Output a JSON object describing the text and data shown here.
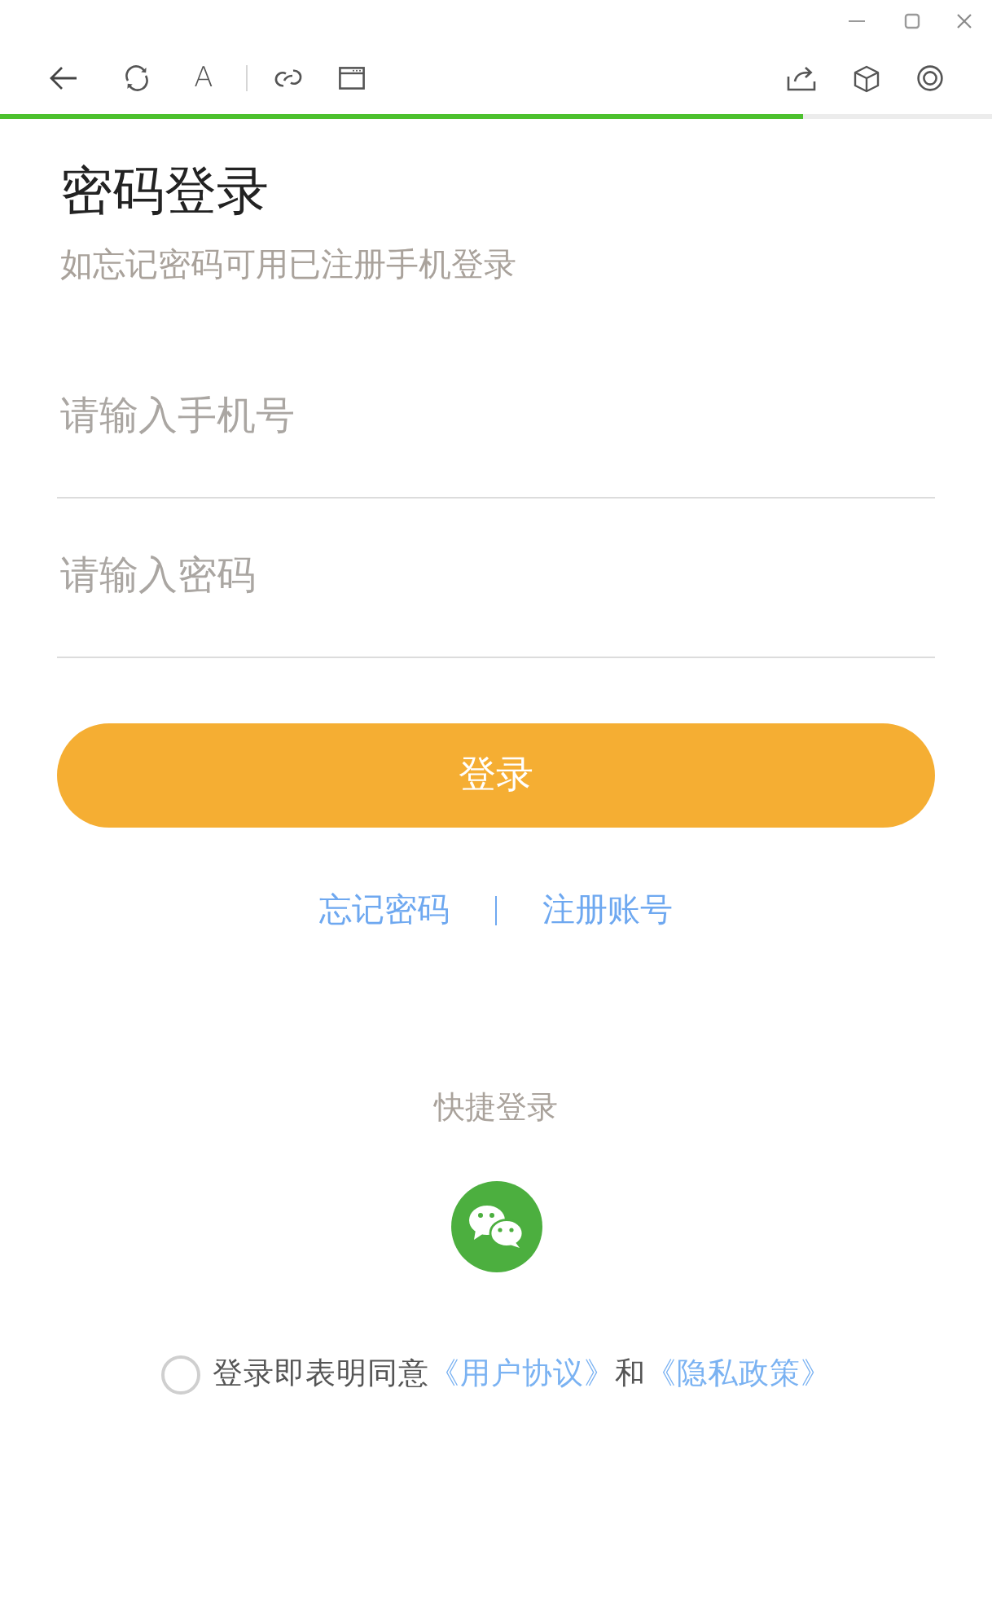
{
  "toolbar": {
    "font_size_label": "A",
    "progress": {
      "level": 0.81
    }
  },
  "title": "密码登录",
  "subtitle": "如忘记密码可用已注册手机登录",
  "phone_field": {
    "placeholder": "请输入手机号"
  },
  "password_field": {
    "placeholder": "请输入密码"
  },
  "login_button": "登录",
  "links": [
    {
      "label": "忘记密码"
    },
    {
      "label": "注册账号"
    }
  ],
  "quick_login": {
    "title": "快捷登录"
  },
  "agreement": {
    "checked": false,
    "parts": [
      {
        "kind": "plain",
        "text": "登录即表明同意"
      },
      {
        "kind": "link",
        "text": "《用户协议》"
      },
      {
        "kind": "plain",
        "text": "和"
      },
      {
        "kind": "link",
        "text": "《隐私政策》"
      }
    ]
  }
}
